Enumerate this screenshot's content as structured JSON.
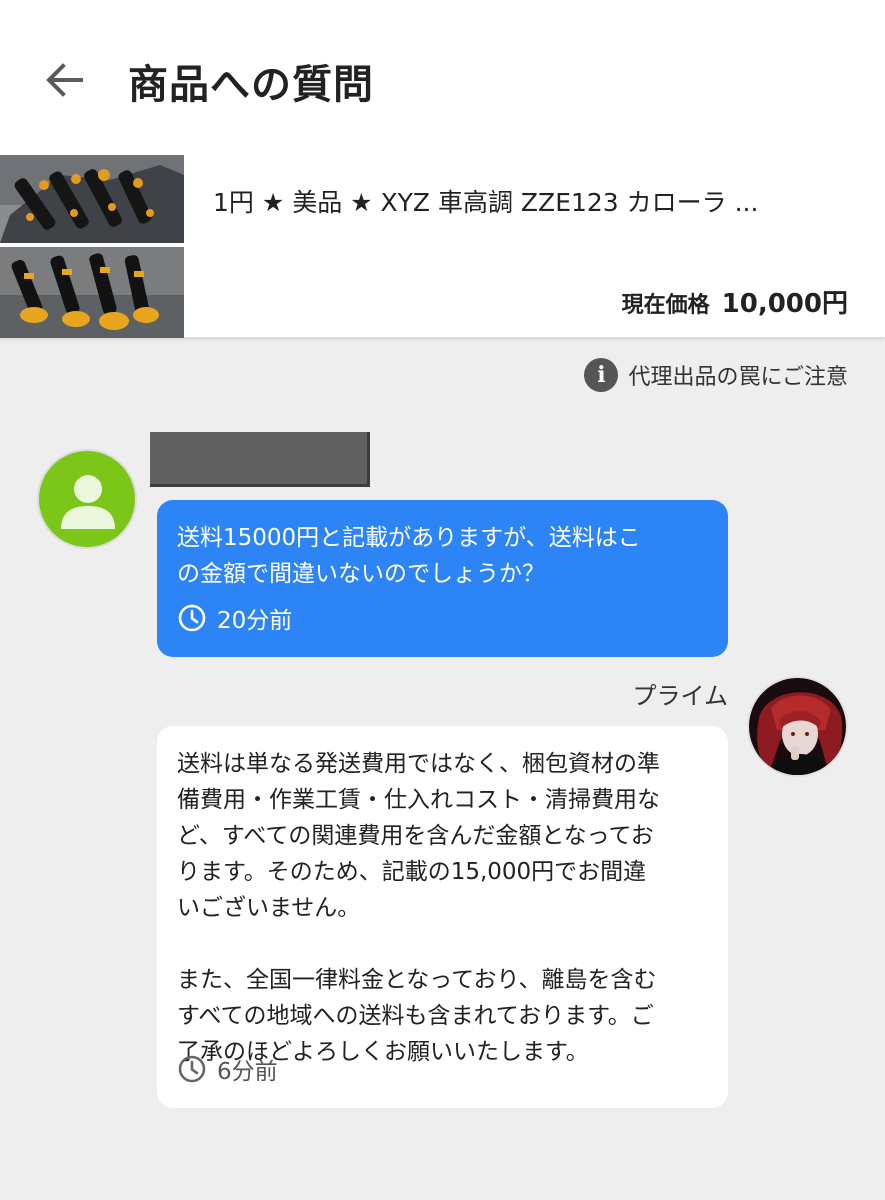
{
  "header": {
    "title": "商品への質問"
  },
  "product": {
    "title": "1円 ★ 美品 ★ XYZ 車高調 ZZE123 カローラ ...",
    "price_label": "現在価格",
    "price_value": "10,000円"
  },
  "notice": {
    "text": "代理出品の罠にご注意"
  },
  "question": {
    "text": "送料15000円と記載がありますが、送料はこ\nの金額で間違いないのでしょうか？",
    "time": "20分前"
  },
  "answer": {
    "seller_name": "プライム",
    "text": "送料は単なる発送費用ではなく、梱包資材の準\n備費用・作業工賃・仕入れコスト・清掃費用な\nど、すべての関連費用を含んだ金額となってお\nります。そのため、記載の15,000円でお間違\nいございません。\n\nまた、全国一律料金となっており、離島を含む\nすべての地域への送料も含まれております。ご\n了承のほどよろしくお願いいたします。",
    "time": "6分前"
  },
  "colors": {
    "question_bubble": "#2d84f5",
    "answer_bubble": "#ffffff",
    "background": "#eeeeee",
    "avatar_generic": "#7cc619"
  },
  "icons": {
    "back": "arrow-left-icon",
    "info": "info-icon",
    "clock": "clock-icon",
    "avatar_placeholder": "person-icon"
  }
}
